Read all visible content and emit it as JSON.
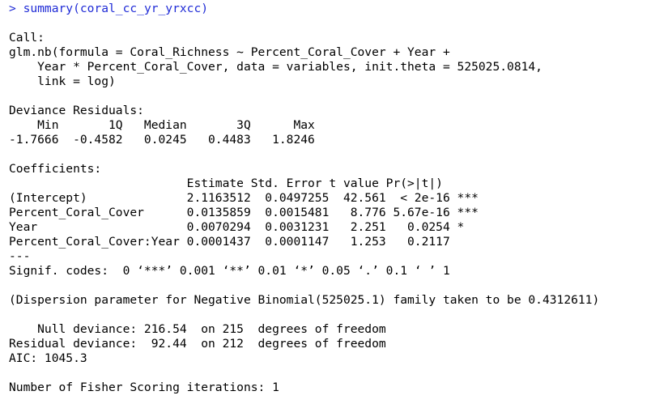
{
  "console": {
    "command_prompt": "> ",
    "command": "summary(coral_cc_yr_yrxcc)",
    "output_lines": [
      "",
      "Call:",
      "glm.nb(formula = Coral_Richness ~ Percent_Coral_Cover + Year +",
      "    Year * Percent_Coral_Cover, data = variables, init.theta = 525025.0814,",
      "    link = log)",
      "",
      "Deviance Residuals:",
      "    Min       1Q   Median       3Q      Max",
      "-1.7666  -0.4582   0.0245   0.4483   1.8246",
      "",
      "Coefficients:",
      "                         Estimate Std. Error t value Pr(>|t|)",
      "(Intercept)              2.1163512  0.0497255  42.561  < 2e-16 ***",
      "Percent_Coral_Cover      0.0135859  0.0015481   8.776 5.67e-16 ***",
      "Year                     0.0070294  0.0031231   2.251   0.0254 *",
      "Percent_Coral_Cover:Year 0.0001437  0.0001147   1.253   0.2117",
      "---",
      "Signif. codes:  0 ‘***’ 0.001 ‘**’ 0.01 ‘*’ 0.05 ‘.’ 0.1 ‘ ’ 1",
      "",
      "(Dispersion parameter for Negative Binomial(525025.1) family taken to be 0.4312611)",
      "",
      "    Null deviance: 216.54  on 215  degrees of freedom",
      "Residual deviance:  92.44  on 212  degrees of freedom",
      "AIC: 1045.3",
      "",
      "Number of Fisher Scoring iterations: 1"
    ]
  }
}
